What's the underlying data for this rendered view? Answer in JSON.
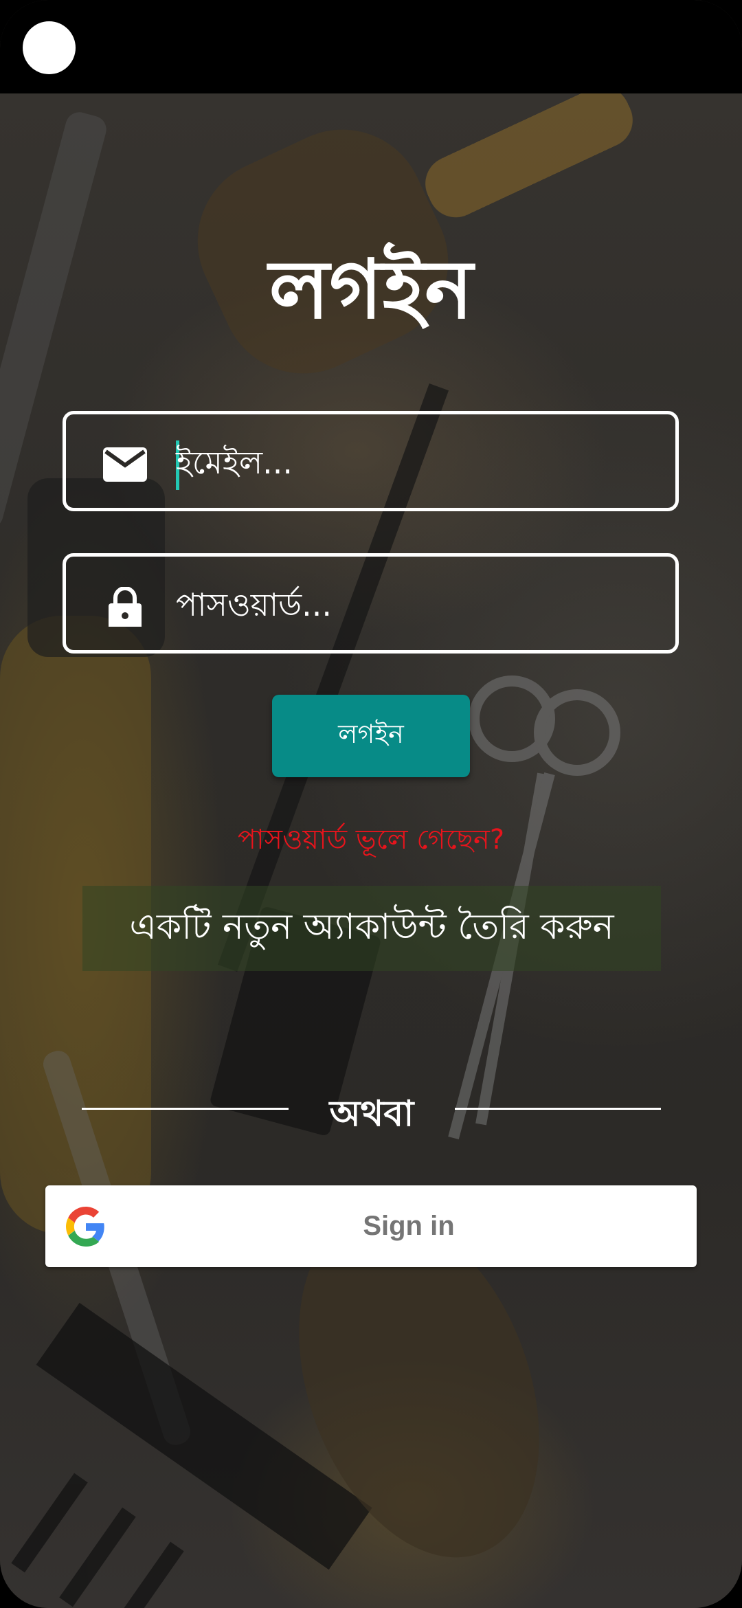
{
  "title": "লগইন",
  "email_field": {
    "placeholder": "ইমেইল...",
    "icon": "mail-icon"
  },
  "password_field": {
    "placeholder": "পাসওয়ার্ড...",
    "icon": "lock-icon"
  },
  "login_button": {
    "label": "লগইন",
    "color": "#078b87"
  },
  "forgot_password": {
    "label": "পাসওয়ার্ড ভূলে গেছেন?",
    "color": "#e8141c"
  },
  "create_account": {
    "label": "একটি নতুন অ্যাকাউন্ট তৈরি করুন"
  },
  "divider": {
    "label": "অথবা"
  },
  "google_signin": {
    "label": "Sign in",
    "icon": "google-logo-icon"
  },
  "colors": {
    "accent": "#078b87",
    "cursor": "#23c8b4",
    "error": "#e8141c"
  }
}
